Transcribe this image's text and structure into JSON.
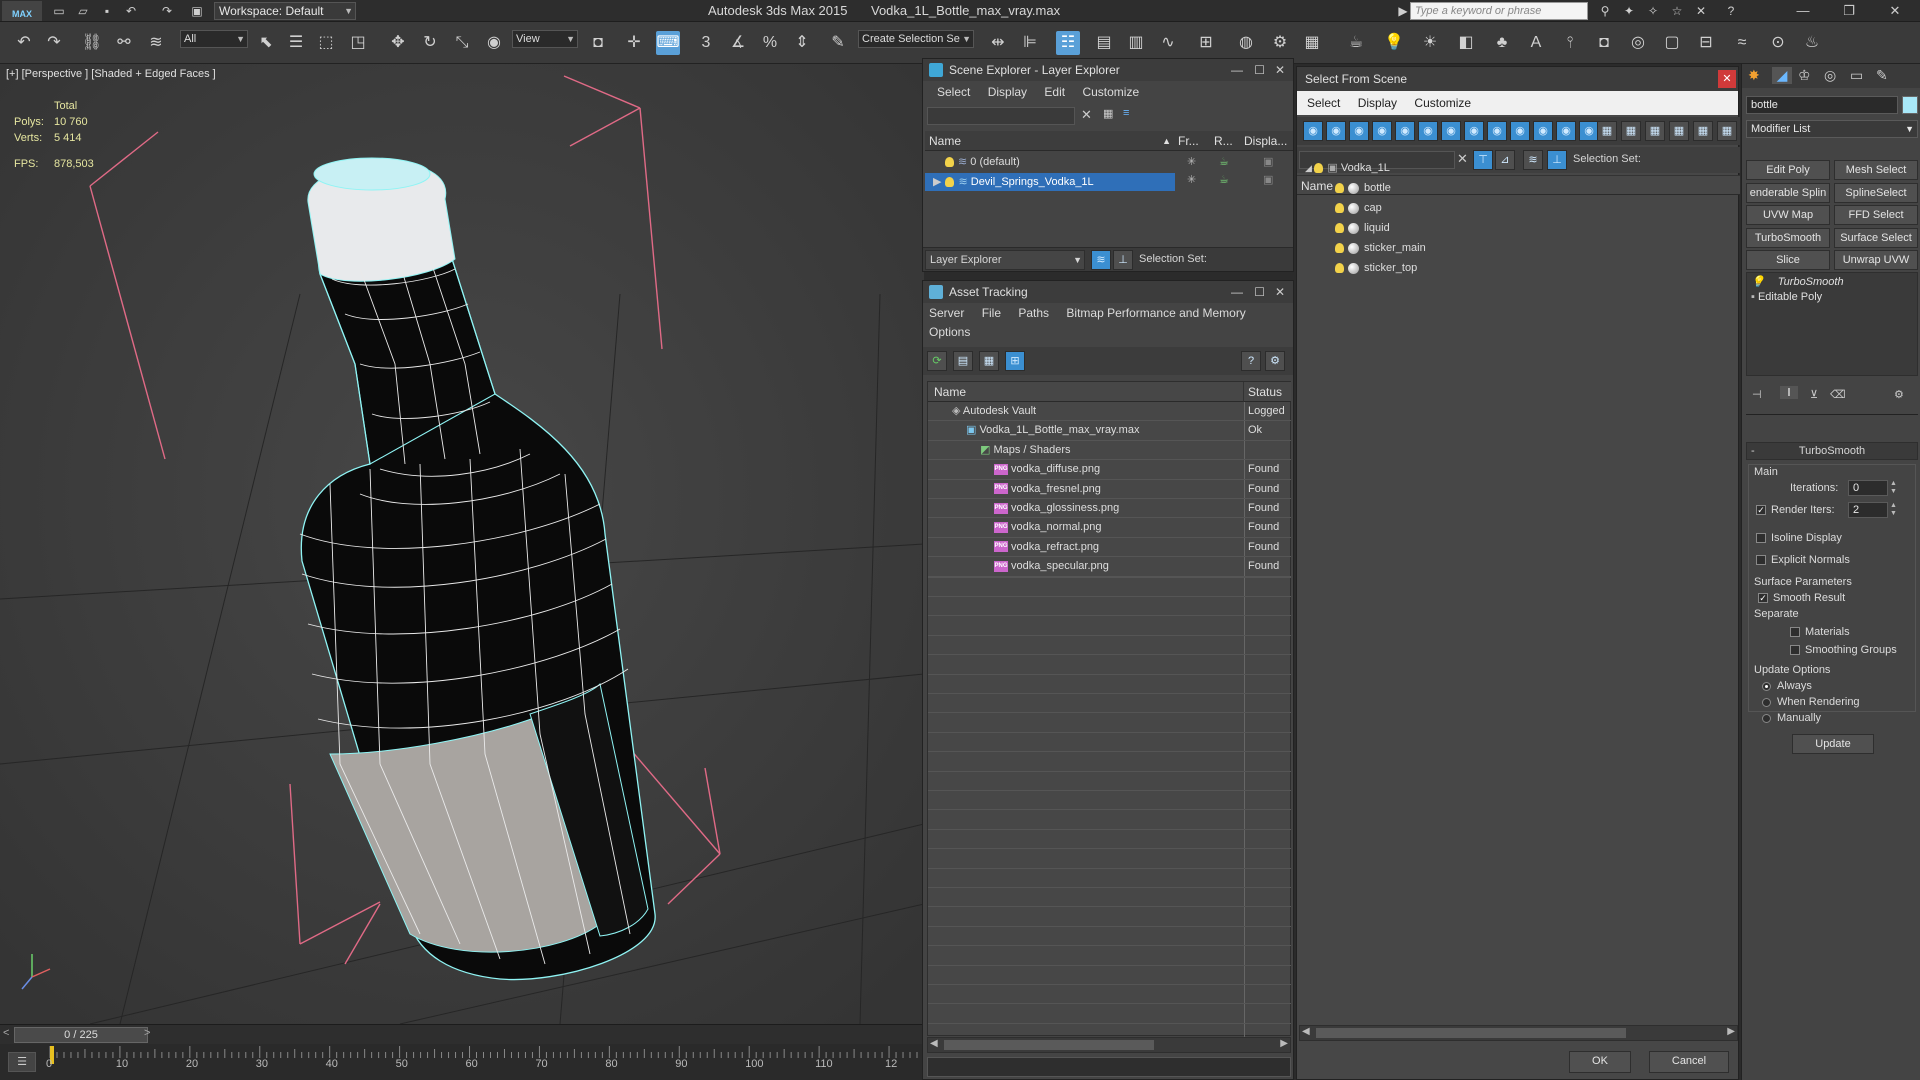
{
  "titlebar": {
    "workspace": "Workspace: Default",
    "app_title": "Autodesk 3ds Max  2015",
    "doc_title": "Vodka_1L_Bottle_max_vray.max",
    "search_placeholder": "Type a keyword or phrase"
  },
  "toolbar": {
    "selection_filter": "All",
    "ref_coord": "View",
    "create_selection_set": "Create Selection Se"
  },
  "viewport": {
    "label": "[+] [Perspective ] [Shaded + Edged Faces ]",
    "stats": {
      "total_label": "Total",
      "polys_label": "Polys:",
      "polys": "10 760",
      "verts_label": "Verts:",
      "verts": "5 414",
      "fps_label": "FPS:",
      "fps": "878,503"
    },
    "colors": {
      "wire": "#8ff4f4",
      "bg": "#3d3d3d",
      "gizmo": "#e0607a"
    }
  },
  "timeslider": {
    "position": "0 / 225",
    "ticks": [
      "0",
      "10",
      "20",
      "30",
      "40",
      "50",
      "60",
      "70",
      "80",
      "90",
      "100",
      "110",
      "12"
    ]
  },
  "scene_explorer": {
    "title": "Scene Explorer - Layer Explorer",
    "menu": [
      "Select",
      "Display",
      "Edit",
      "Customize"
    ],
    "columns": [
      "Name",
      "Fr...",
      "R...",
      "Displa..."
    ],
    "rows": [
      {
        "name": "0 (default)",
        "selected": false
      },
      {
        "name": "Devil_Springs_Vodka_1L",
        "selected": true
      }
    ],
    "footer_explorer": "Layer Explorer",
    "footer_selset": "Selection Set:"
  },
  "asset_tracking": {
    "title": "Asset Tracking",
    "menu_line1": [
      "Server",
      "File",
      "Paths",
      "Bitmap Performance and Memory"
    ],
    "menu_line2": [
      "Options"
    ],
    "columns": [
      "Name",
      "Status"
    ],
    "rows": [
      {
        "name": "Autodesk Vault",
        "status": "Logged",
        "indent": 1,
        "icon": "vault"
      },
      {
        "name": "Vodka_1L_Bottle_max_vray.max",
        "status": "Ok",
        "indent": 2,
        "icon": "max"
      },
      {
        "name": "Maps / Shaders",
        "status": "",
        "indent": 3,
        "icon": "maps"
      },
      {
        "name": "vodka_diffuse.png",
        "status": "Found",
        "indent": 4,
        "icon": "png"
      },
      {
        "name": "vodka_fresnel.png",
        "status": "Found",
        "indent": 4,
        "icon": "png"
      },
      {
        "name": "vodka_glossiness.png",
        "status": "Found",
        "indent": 4,
        "icon": "png"
      },
      {
        "name": "vodka_normal.png",
        "status": "Found",
        "indent": 4,
        "icon": "png"
      },
      {
        "name": "vodka_refract.png",
        "status": "Found",
        "indent": 4,
        "icon": "png"
      },
      {
        "name": "vodka_specular.png",
        "status": "Found",
        "indent": 4,
        "icon": "png"
      }
    ]
  },
  "select_from_scene": {
    "title": "Select From Scene",
    "menu": [
      "Select",
      "Display",
      "Customize"
    ],
    "selection_set_label": "Selection Set:",
    "column": "Name",
    "tree": [
      {
        "name": "Vodka_1L",
        "level": 0
      },
      {
        "name": "bottle",
        "level": 1
      },
      {
        "name": "cap",
        "level": 1
      },
      {
        "name": "liquid",
        "level": 1
      },
      {
        "name": "sticker_main",
        "level": 1
      },
      {
        "name": "sticker_top",
        "level": 1
      }
    ],
    "ok": "OK",
    "cancel": "Cancel"
  },
  "command_panel": {
    "object_name": "bottle",
    "modifier_list": "Modifier List",
    "mod_buttons": [
      [
        "Edit Poly",
        "Mesh Select"
      ],
      [
        "enderable Splin",
        "SplineSelect"
      ],
      [
        "UVW Map",
        "FFD Select"
      ],
      [
        "TurboSmooth",
        "Surface Select"
      ],
      [
        "Slice",
        "Unwrap UVW"
      ]
    ],
    "stack": [
      "TurboSmooth",
      "Editable Poly"
    ],
    "rollout_title": "TurboSmooth",
    "main_label": "Main",
    "iterations_label": "Iterations:",
    "iterations": "0",
    "render_iters_label": "Render Iters:",
    "render_iters": "2",
    "isoline": "Isoline Display",
    "explicit_normals": "Explicit Normals",
    "surface_params": "Surface Parameters",
    "smooth_result": "Smooth Result",
    "separate": "Separate",
    "materials": "Materials",
    "smoothing_groups": "Smoothing Groups",
    "update_options": "Update Options",
    "always": "Always",
    "when_rendering": "When Rendering",
    "manually": "Manually",
    "update": "Update"
  }
}
